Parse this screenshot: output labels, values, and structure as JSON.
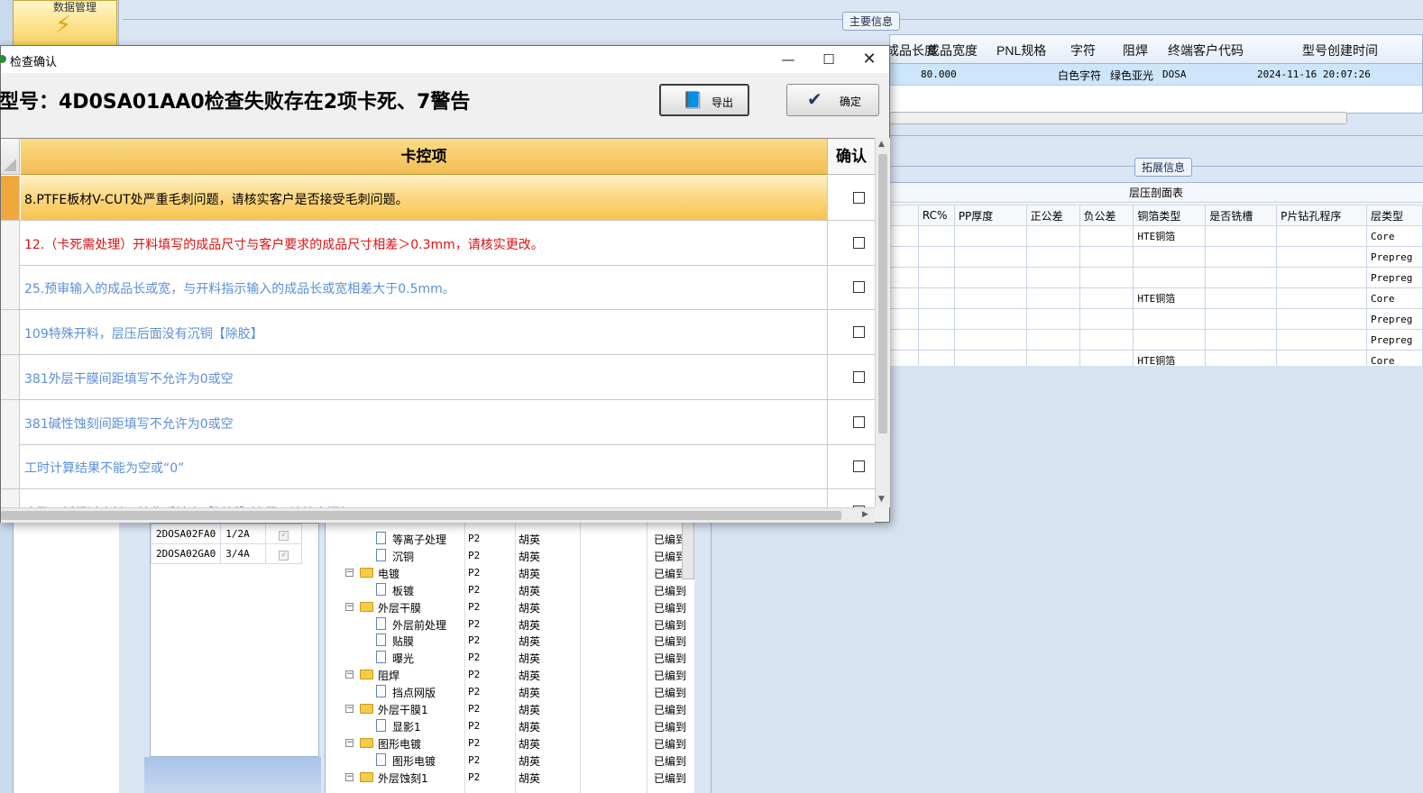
{
  "app": {
    "module_label": "数据管理",
    "main_info_title": "主要信息",
    "ext_info_title": "拓展信息",
    "main_grid": {
      "headers": [
        "成品长度",
        "成品宽度",
        "PNL规格",
        "字符",
        "阻焊",
        "终端客户代码",
        "型号创建时间"
      ],
      "row": [
        "80.000",
        "白色字符",
        "绿色亚光",
        "DOSA",
        "2024-11-16 20:07:26"
      ]
    },
    "layer_grid": {
      "caption": "层压剖面表",
      "headers": [
        "RC%",
        "PP厚度",
        "正公差",
        "负公差",
        "铜箔类型",
        "是否铣槽",
        "P片钻孔程序",
        "层类型"
      ],
      "rows": [
        {
          "copper": "HTE铜箔",
          "type": "Core"
        },
        {
          "copper": "",
          "type": "Prepreg"
        },
        {
          "copper": "",
          "type": "Prepreg"
        },
        {
          "copper": "HTE铜箔",
          "type": "Core"
        },
        {
          "copper": "",
          "type": "Prepreg"
        },
        {
          "copper": "",
          "type": "Prepreg"
        },
        {
          "copper": "HTE铜箔",
          "type": "Core"
        }
      ]
    },
    "code_grid": [
      {
        "code": "2DOSA02FA0",
        "ratio": "1/2A"
      },
      {
        "code": "2DOSA02GA0",
        "ratio": "3/4A"
      }
    ],
    "tree": [
      {
        "level": 2,
        "kind": "doc",
        "name": "等离子处理",
        "c1": "P2",
        "c2": "胡英",
        "c3": "已编到"
      },
      {
        "level": 2,
        "kind": "doc",
        "name": "沉铜",
        "c1": "P2",
        "c2": "胡英",
        "c3": "已编到"
      },
      {
        "level": 1,
        "kind": "folder",
        "name": "电镀",
        "c1": "P2",
        "c2": "胡英",
        "c3": "已编到"
      },
      {
        "level": 2,
        "kind": "doc",
        "name": "板镀",
        "c1": "P2",
        "c2": "胡英",
        "c3": "已编到"
      },
      {
        "level": 1,
        "kind": "folder",
        "name": "外层干膜",
        "c1": "P2",
        "c2": "胡英",
        "c3": "已编到"
      },
      {
        "level": 2,
        "kind": "doc",
        "name": "外层前处理",
        "c1": "P2",
        "c2": "胡英",
        "c3": "已编到"
      },
      {
        "level": 2,
        "kind": "doc",
        "name": "贴膜",
        "c1": "P2",
        "c2": "胡英",
        "c3": "已编到"
      },
      {
        "level": 2,
        "kind": "doc",
        "name": "曝光",
        "c1": "P2",
        "c2": "胡英",
        "c3": "已编到"
      },
      {
        "level": 1,
        "kind": "folder",
        "name": "阻焊",
        "c1": "P2",
        "c2": "胡英",
        "c3": "已编到"
      },
      {
        "level": 2,
        "kind": "doc",
        "name": "挡点网版",
        "c1": "P2",
        "c2": "胡英",
        "c3": "已编到"
      },
      {
        "level": 1,
        "kind": "folder",
        "name": "外层干膜1",
        "c1": "P2",
        "c2": "胡英",
        "c3": "已编到"
      },
      {
        "level": 2,
        "kind": "doc",
        "name": "显影1",
        "c1": "P2",
        "c2": "胡英",
        "c3": "已编到"
      },
      {
        "level": 1,
        "kind": "folder",
        "name": "图形电镀",
        "c1": "P2",
        "c2": "胡英",
        "c3": "已编到"
      },
      {
        "level": 2,
        "kind": "doc",
        "name": "图形电镀",
        "c1": "P2",
        "c2": "胡英",
        "c3": "已编到"
      },
      {
        "level": 1,
        "kind": "folder",
        "name": "外层蚀刻1",
        "c1": "P2",
        "c2": "胡英",
        "c3": "已编到"
      }
    ]
  },
  "dialog": {
    "title": "检查确认",
    "heading": "型号：4D0SA01AA0检查失败存在2项卡死、7警告",
    "export_label": "导出",
    "confirm_label": "确定",
    "col_item": "卡控项",
    "col_confirm": "确认",
    "items": [
      {
        "text": "8.PTFE板材V-CUT处严重毛刺问题，请核实客户是否接受毛刺问题。",
        "color": "black",
        "selected": true
      },
      {
        "text": "12.（卡死需处理）开料填写的成品尺寸与客户要求的成品尺寸相差＞0.3mm，请核实更改。",
        "color": "red",
        "selected": false
      },
      {
        "text": "25.预审输入的成品长或宽，与开料指示输入的成品长或宽相差大于0.5mm。",
        "color": "blue",
        "selected": false
      },
      {
        "text": "109特殊开料，层压后面没有沉铜【除胶】",
        "color": "blue",
        "selected": false
      },
      {
        "text": "381外层干膜间距填写不允许为0或空",
        "color": "blue",
        "selected": false
      },
      {
        "text": "381碱性蚀刻间距填写不允许为0或空",
        "color": "blue",
        "selected": false
      },
      {
        "text": "工时计算结果不能为空或“0”",
        "color": "blue",
        "selected": false
      },
      {
        "text": "盲孔子板经过电镀，按化后缺少【树板】流程，请核实添加",
        "color": "blue",
        "selected": false
      }
    ]
  }
}
